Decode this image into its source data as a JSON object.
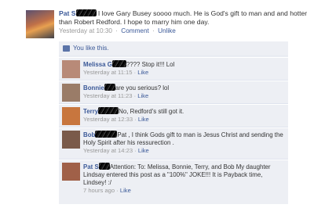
{
  "post": {
    "author": "Pat S",
    "text": "I love Gary Busey soooo much. He is God's gift to man and and hotter than Robert Redford. I hope to marry him one day.",
    "timestamp": "Yesterday at 10:30",
    "separator": "·",
    "comment_label": "Comment",
    "unlike_label": "Unlike"
  },
  "likes": {
    "text": "You like this."
  },
  "comments": [
    {
      "author": "Melissa G",
      "text": "???? Stop it!!! Lol",
      "timestamp": "Yesterday at 11:15",
      "like_label": "Like",
      "avatar_color": "#b88a78"
    },
    {
      "author": "Bonnie",
      "text": "are you serious? lol",
      "timestamp": "Yesterday at 11:23",
      "like_label": "Like",
      "avatar_color": "#9a7c68"
    },
    {
      "author": "Terry",
      "text": "No, Redford's still got it.",
      "timestamp": "Yesterday at 12:33",
      "like_label": "Like",
      "avatar_color": "#c8763e"
    },
    {
      "author": "Bob",
      "text": "Pat , I think Gods gift to man is Jesus Christ and sending the Holy Spirit after his ressurection .",
      "timestamp": "Yesterday at 14:23",
      "like_label": "Like",
      "avatar_color": "#7a5a4a"
    },
    {
      "author": "Pat S",
      "text": "Attention: To: Melissa, Bonnie, Terry, and Bob My daughter Lindsay entered this post as a \"100%\" JOKE!!! It is Payback time, Lindsey! :/",
      "timestamp": "7 hours ago",
      "like_label": "Like",
      "avatar_color": "#a06048"
    }
  ]
}
